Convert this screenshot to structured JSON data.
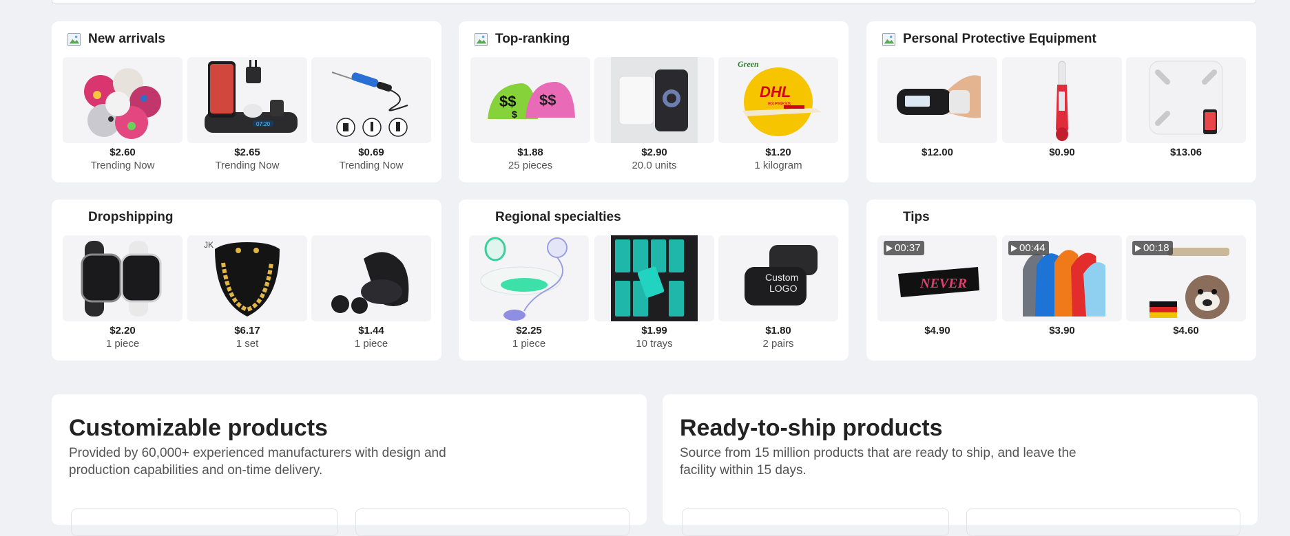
{
  "cards": [
    {
      "title": "New arrivals",
      "products": [
        {
          "price": "$2.60",
          "sub": "Trending Now",
          "image": "printed-bandanas"
        },
        {
          "price": "$2.65",
          "sub": "Trending Now",
          "image": "wireless-charging-station"
        },
        {
          "price": "$0.69",
          "sub": "Trending Now",
          "image": "soldering-iron"
        }
      ]
    },
    {
      "title": "Top-ranking",
      "products": [
        {
          "price": "$1.88",
          "sub": "25 pieces",
          "image": "dollar-beanies"
        },
        {
          "price": "$2.90",
          "sub": "20.0 units",
          "image": "power-bank-phone"
        },
        {
          "price": "$1.20",
          "sub": "1 kilogram",
          "image": "dhl-express-logo"
        }
      ]
    },
    {
      "title": "Personal Protective Equipment",
      "products": [
        {
          "price": "$12.00",
          "sub": "",
          "image": "pulse-oximeter"
        },
        {
          "price": "$0.90",
          "sub": "",
          "image": "digital-thermometer"
        },
        {
          "price": "$13.06",
          "sub": "",
          "image": "smart-scale"
        }
      ]
    },
    {
      "title": "Dropshipping",
      "products": [
        {
          "price": "$2.20",
          "sub": "1 piece",
          "image": "smartwatches"
        },
        {
          "price": "$6.17",
          "sub": "1 set",
          "image": "gold-necklace-set"
        },
        {
          "price": "$1.44",
          "sub": "1 piece",
          "image": "earbuds"
        }
      ]
    },
    {
      "title": "Regional specialties",
      "products": [
        {
          "price": "$2.25",
          "sub": "1 piece",
          "image": "sitz-bath"
        },
        {
          "price": "$1.99",
          "sub": "10 trays",
          "image": "eyelash-trays"
        },
        {
          "price": "$1.80",
          "sub": "2 pairs",
          "image": "custom-logo-slides"
        }
      ]
    },
    {
      "title": "Tips",
      "products": [
        {
          "price": "$4.90",
          "sub": "",
          "duration": "00:37",
          "image": "never-banner"
        },
        {
          "price": "$3.90",
          "sub": "",
          "duration": "00:44",
          "image": "hoodies"
        },
        {
          "price": "$4.60",
          "sub": "",
          "duration": "00:18",
          "image": "dog-collars"
        }
      ]
    }
  ],
  "customizable": {
    "title": "Customizable products",
    "desc": "Provided by 60,000+ experienced manufacturers with design and production capabilities and on-time delivery."
  },
  "ready_to_ship": {
    "title": "Ready-to-ship products",
    "desc": "Source from 15 million products that are ready to ship, and leave the facility within 15 days."
  },
  "colors": {
    "page_bg": "#f0f1f5",
    "card_bg": "#ffffff",
    "text": "#222222",
    "muted": "#555555"
  }
}
